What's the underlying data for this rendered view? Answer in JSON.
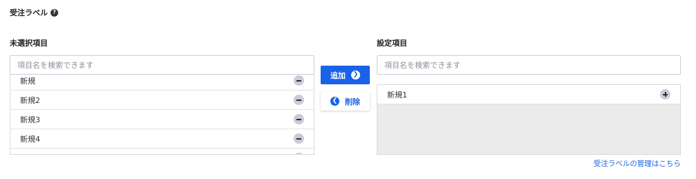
{
  "section": {
    "title": "受注ラベル",
    "help_icon": "question-circle-icon",
    "help_glyph": "?"
  },
  "unselected": {
    "label": "未選択項目",
    "search_placeholder": "項目名を検索できます",
    "items": [
      {
        "label": "新規"
      },
      {
        "label": "新規2"
      },
      {
        "label": "新規3"
      },
      {
        "label": "新規4"
      },
      {
        "label": ""
      }
    ]
  },
  "actions": {
    "add_label": "追加",
    "add_glyph": "❯",
    "remove_label": "削除",
    "remove_glyph": "❮"
  },
  "selected": {
    "label": "設定項目",
    "search_placeholder": "項目名を検索できます",
    "items": [
      {
        "label": "新規1"
      }
    ]
  },
  "footer": {
    "manage_link": "受注ラベルの管理はこちら"
  },
  "colors": {
    "primary": "#1a62e8",
    "row_border": "#dfe2e6",
    "icon_bg": "#c9ccd7"
  }
}
